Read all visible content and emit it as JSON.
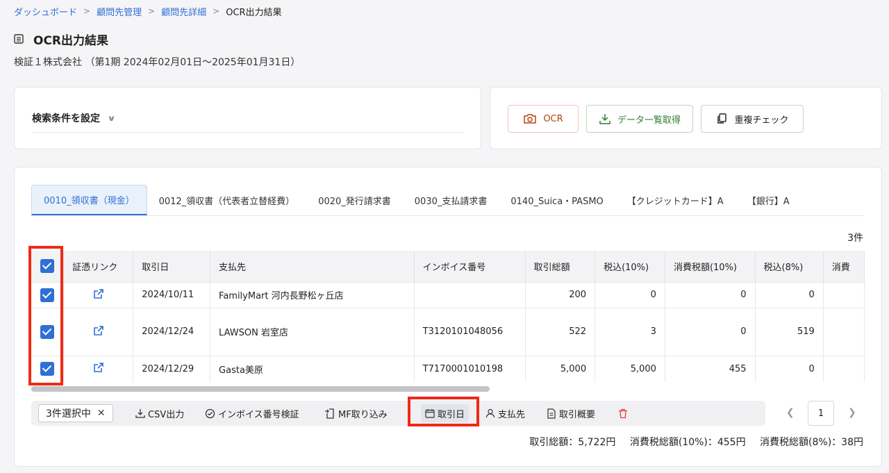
{
  "breadcrumb": {
    "items": [
      "ダッシュボード",
      "顧問先管理",
      "顧問先詳細"
    ],
    "current": "OCR出力結果",
    "separator": ">"
  },
  "page": {
    "title": "OCR出力結果",
    "title_icon": "document-list-icon",
    "subtitle": "検証１株式会社 （第1期 2024年02月01日〜2025年01月31日）"
  },
  "search": {
    "label": "検索条件を設定",
    "icon": "chevron-down-icon"
  },
  "actions": {
    "ocr_label": "OCR",
    "data_label": "データ一覧取得",
    "dup_label": "重複チェック",
    "ocr_icon": "camera-icon",
    "data_icon": "download-icon",
    "dup_icon": "copy-icon"
  },
  "tabs": [
    {
      "label": "0010_領収書（現金）",
      "active": true
    },
    {
      "label": "0012_領収書（代表者立替経費）"
    },
    {
      "label": "0020_発行請求書"
    },
    {
      "label": "0030_支払請求書"
    },
    {
      "label": "0140_Suica・PASMO"
    },
    {
      "label": "【クレジットカード】A"
    },
    {
      "label": "【銀行】A"
    }
  ],
  "count_text": "3件",
  "table": {
    "headers": [
      "証憑リンク",
      "取引日",
      "支払先",
      "インボイス番号",
      "取引総額",
      "税込(10%)",
      "消費税額(10%)",
      "税込(8%)",
      "消費"
    ],
    "rows": [
      {
        "date": "2024/10/11",
        "payee": "FamilyMart 河内長野松ヶ丘店",
        "invoice": "",
        "total": "200",
        "tax_incl_10": "0",
        "tax_10": "0",
        "tax_incl_8": "0",
        "checked": true
      },
      {
        "date": "2024/12/24",
        "payee": "LAWSON 岩室店",
        "invoice": "T3120101048056",
        "total": "522",
        "tax_incl_10": "3",
        "tax_10": "0",
        "tax_incl_8": "519",
        "checked": true
      },
      {
        "date": "2024/12/29",
        "payee": "Gasta美原",
        "invoice": "T7170001010198",
        "total": "5,000",
        "tax_incl_10": "5,000",
        "tax_10": "455",
        "tax_incl_8": "0",
        "checked": true
      }
    ],
    "link_icon": "external-link-icon"
  },
  "bulk_bar": {
    "selected": "3件選択中",
    "csv": "CSV出力",
    "invoice_check": "インボイス番号検証",
    "mf_import": "MF取り込み",
    "date": "取引日",
    "payee": "支払先",
    "summary": "取引概要",
    "colors": {
      "accent": "#2f6fd6",
      "delete": "#e53935",
      "highlight": "#f02a16"
    }
  },
  "pagination": {
    "page": "1"
  },
  "totals": {
    "total": "取引総額：5,722円",
    "tax_10": "消費税総額(10%)：455円",
    "tax_8": "消費税総額(8%)：38円"
  }
}
